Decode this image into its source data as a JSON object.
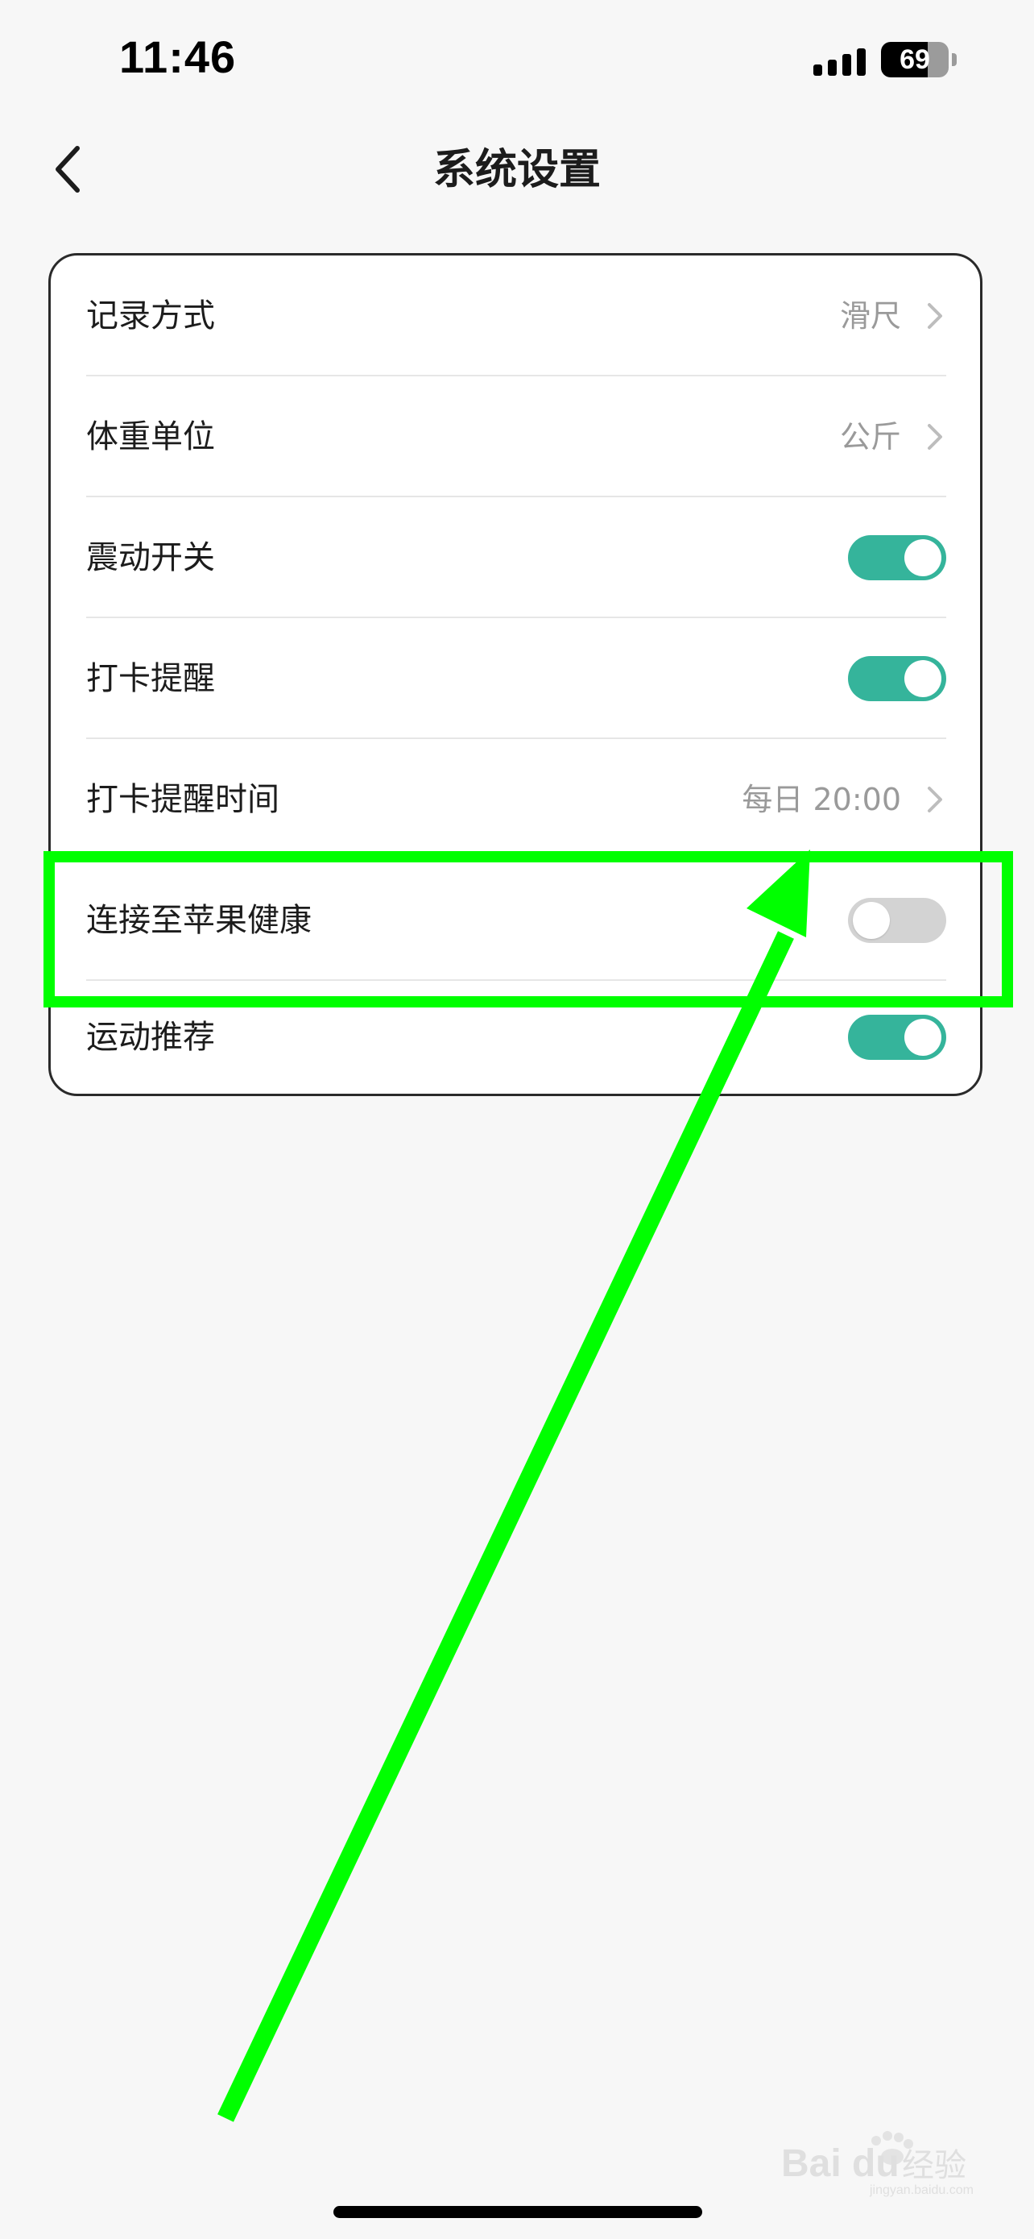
{
  "status_bar": {
    "time": "11:46",
    "battery": "69"
  },
  "nav": {
    "title": "系统设置",
    "back_icon": "chevron-left-icon"
  },
  "settings": [
    {
      "label": "记录方式",
      "value": "滑尺",
      "control": "chevron"
    },
    {
      "label": "体重单位",
      "value": "公斤",
      "control": "chevron"
    },
    {
      "label": "震动开关",
      "control": "toggle",
      "on": true
    },
    {
      "label": "打卡提醒",
      "control": "toggle",
      "on": true
    },
    {
      "label": "打卡提醒时间",
      "value": "每日 20:00",
      "control": "chevron"
    },
    {
      "label": "连接至苹果健康",
      "control": "toggle",
      "on": false
    },
    {
      "label": "运动推荐",
      "control": "toggle",
      "on": true
    }
  ],
  "colors": {
    "toggle_on": "#35b49b",
    "toggle_off": "#d3d3d3",
    "annotation": "#00ff00",
    "background": "#f7f7f7"
  },
  "watermark": {
    "text": "Baidu 经验",
    "subtext": "jingyan.baidu.com"
  }
}
